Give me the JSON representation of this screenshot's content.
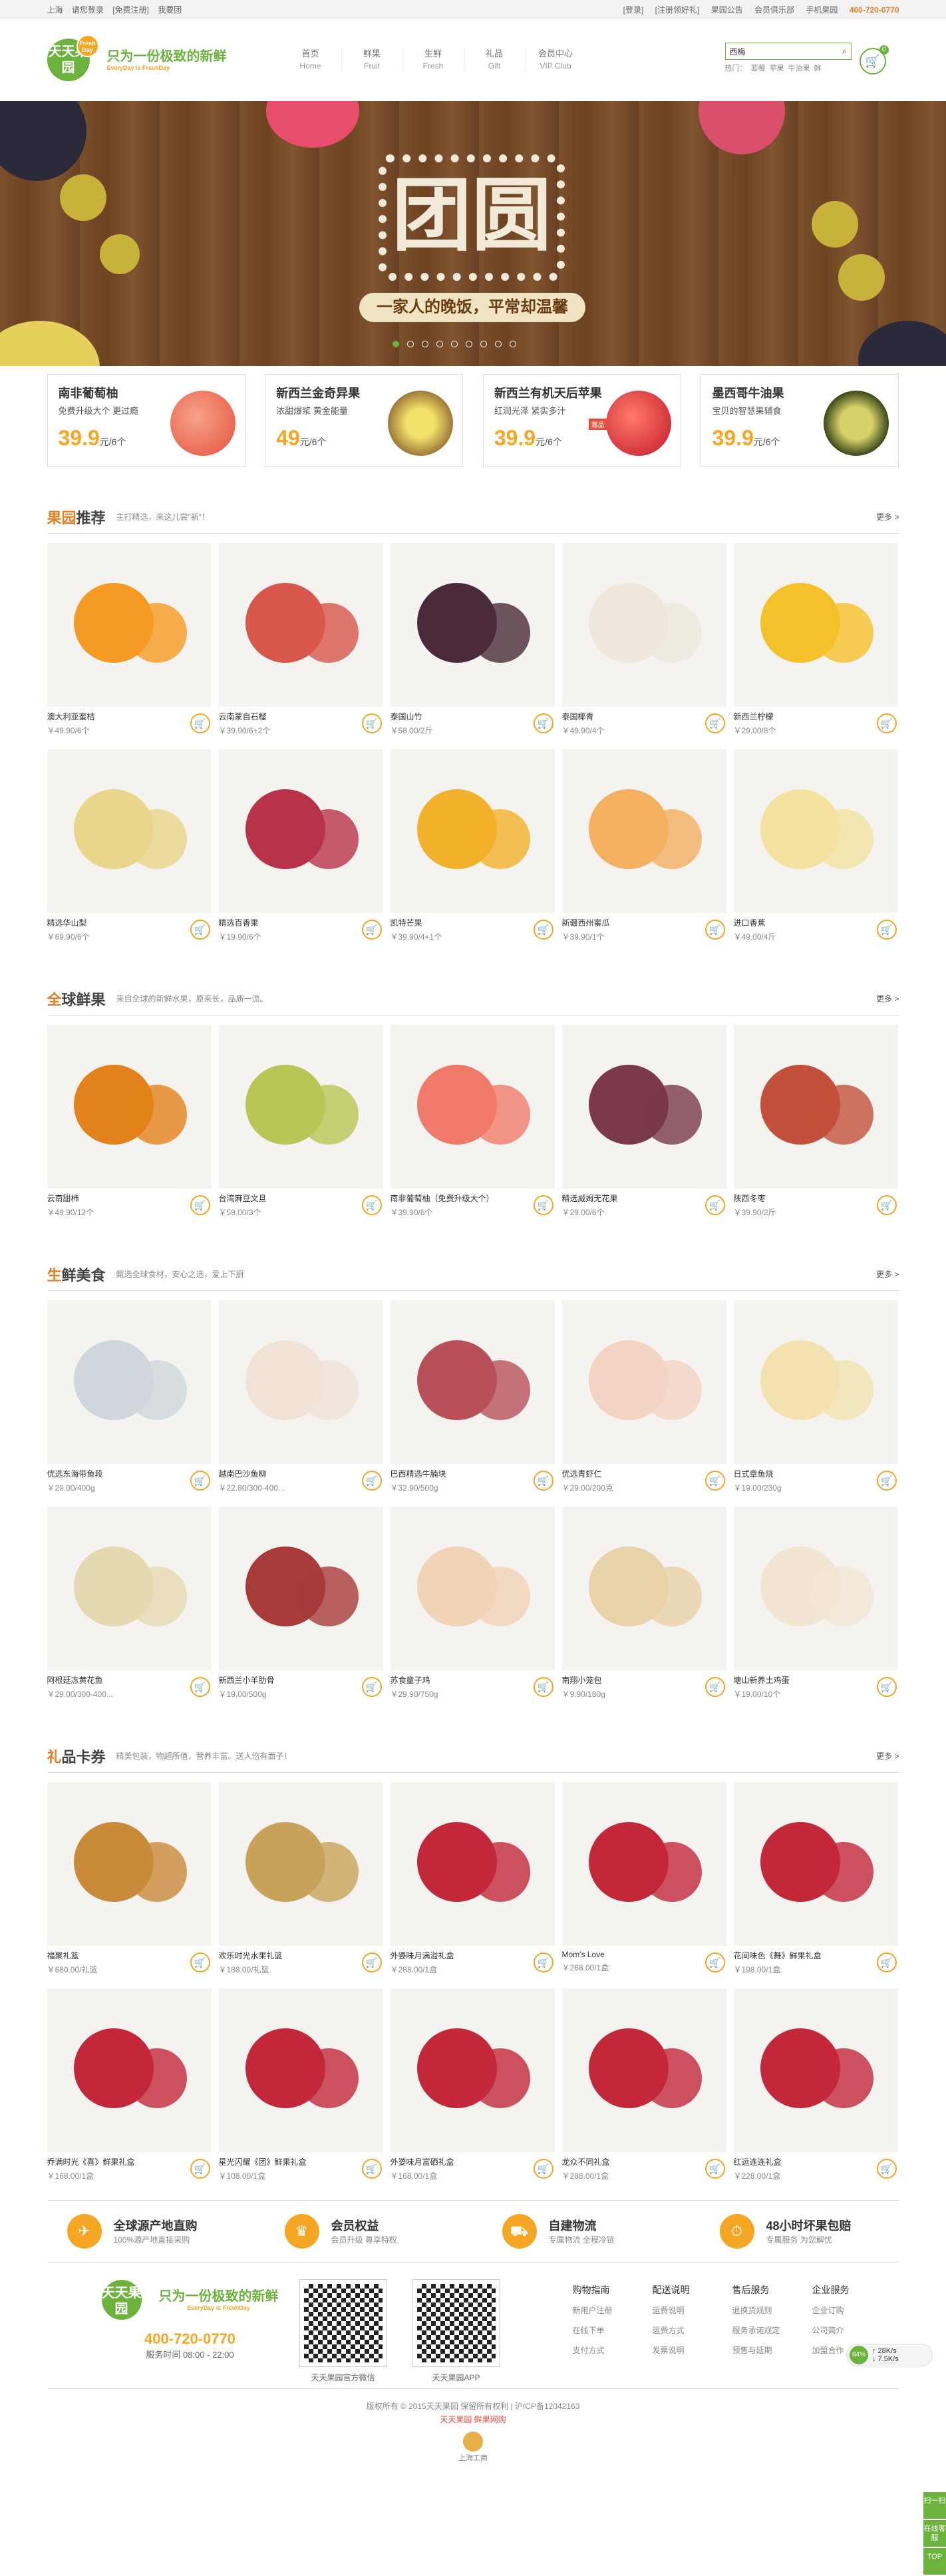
{
  "topbar": {
    "left": [
      "上海",
      "请您登录",
      "[免费注册]",
      "我要团"
    ],
    "right": [
      "[登录]",
      "[注册领好礼]",
      "果园公告",
      "会员俱乐部",
      "手机果园"
    ],
    "phone": "400-720-0770"
  },
  "logo": {
    "name": "天天果园",
    "tag": "Fresh Day",
    "slogan": "只为一份极致的新鲜",
    "slogan_en": "EveryDay is FreshDay"
  },
  "nav": [
    {
      "cn": "首页",
      "en": "Home"
    },
    {
      "cn": "鲜果",
      "en": "Fruit"
    },
    {
      "cn": "生鲜",
      "en": "Fresh"
    },
    {
      "cn": "礼品",
      "en": "Gift"
    },
    {
      "cn": "会员中心",
      "en": "VIP Club"
    }
  ],
  "search": {
    "placeholder": "西梅",
    "hot": [
      "热门：",
      "蓝莓",
      "苹果",
      "牛油果",
      "鲜"
    ]
  },
  "cart": {
    "count": "0"
  },
  "banner": {
    "title": "团圆",
    "slogan": "一家人的晚饭，平常却温馨"
  },
  "promos": [
    {
      "title": "南非葡萄柚",
      "desc": "免费升级大个 更过瘾",
      "price": "39.9",
      "unit": "元/6个",
      "tag": ""
    },
    {
      "title": "新西兰金奇异果",
      "desc": "浓甜爆浆 黄金能量",
      "price": "49",
      "unit": "元/6个",
      "tag": ""
    },
    {
      "title": "新西兰有机天后苹果",
      "desc": "红润光泽 紧实多汁",
      "price": "39.9",
      "unit": "元/6个",
      "tag": "赠品"
    },
    {
      "title": "墨西哥牛油果",
      "desc": "宝贝的智慧果辅食",
      "price": "39.9",
      "unit": "元/6个",
      "tag": ""
    }
  ],
  "sections": [
    {
      "title_first": "果园",
      "title_rest": "推荐",
      "subtitle": "主打精选，来这儿尝\"新\"！",
      "more": "更多 >",
      "items": [
        {
          "name": "澳大利亚蜜桔",
          "price": "￥49.90/6个"
        },
        {
          "name": "云南蒙自石榴",
          "price": "￥39.90/6+2个"
        },
        {
          "name": "泰国山竹",
          "price": "￥58.00/2斤"
        },
        {
          "name": "泰国椰青",
          "price": "￥49.90/4个"
        },
        {
          "name": "新西兰柠檬",
          "price": "￥29.00/8个"
        },
        {
          "name": "精选华山梨",
          "price": "￥69.90/6个"
        },
        {
          "name": "精选百香果",
          "price": "￥19.90/6个"
        },
        {
          "name": "凯特芒果",
          "price": "￥39.90/4+1个"
        },
        {
          "name": "新疆西州蜜瓜",
          "price": "￥39.90/1个"
        },
        {
          "name": "进口香蕉",
          "price": "￥49.00/4斤"
        }
      ]
    },
    {
      "title_first": "全",
      "title_rest": "球鲜果",
      "subtitle": "来自全球的新鲜水果，原来长，品质一流。",
      "more": "更多 >",
      "items": [
        {
          "name": "云南甜柿",
          "price": "￥49.90/12个"
        },
        {
          "name": "台湾麻豆文旦",
          "price": "￥59.00/3个"
        },
        {
          "name": "南非葡萄柚（免费升级大个）",
          "price": "￥39.90/6个"
        },
        {
          "name": "精选威姆无花果",
          "price": "￥29.00/6个"
        },
        {
          "name": "陕西冬枣",
          "price": "￥39.90/2斤"
        }
      ]
    },
    {
      "title_first": "生",
      "title_rest": "鲜美食",
      "subtitle": "甄选全球食材，安心之选，爱上下厨",
      "more": "更多 >",
      "items": [
        {
          "name": "优选东海带鱼段",
          "price": "￥29.00/400g"
        },
        {
          "name": "越南巴沙鱼柳",
          "price": "￥22.80/300-400..."
        },
        {
          "name": "巴西精选牛腩块",
          "price": "￥32.90/500g"
        },
        {
          "name": "优选青虾仁",
          "price": "￥29.00/200克"
        },
        {
          "name": "日式章鱼烧",
          "price": "￥19.00/230g"
        },
        {
          "name": "阿根廷冻黄花鱼",
          "price": "￥29.00/300-400..."
        },
        {
          "name": "新西兰小羊肋骨",
          "price": "￥19.00/500g"
        },
        {
          "name": "苏食童子鸡",
          "price": "￥29.90/750g"
        },
        {
          "name": "南翔小笼包",
          "price": "￥9.90/180g"
        },
        {
          "name": "塘山新养土鸡蛋",
          "price": "￥19.00/10个"
        }
      ]
    },
    {
      "title_first": "礼",
      "title_rest": "品卡券",
      "subtitle": "精美包装，物超所值，营养丰富。送人倍有面子！",
      "more": "更多 >",
      "items": [
        {
          "name": "福聚礼篮",
          "price": "￥680.00/礼篮"
        },
        {
          "name": "欢乐时光水果礼篮",
          "price": "￥188.00/礼篮"
        },
        {
          "name": "外婆味月满溢礼盒",
          "price": "￥288.00/1盒"
        },
        {
          "name": "Mom's Love",
          "price": "￥268.00/1盒"
        },
        {
          "name": "花间味色《舞》鲜果礼盒",
          "price": "￥198.00/1盒"
        },
        {
          "name": "乔满时光《喜》鲜果礼盒",
          "price": "￥168.00/1盒"
        },
        {
          "name": "星光闪耀《团》鲜果礼盒",
          "price": "￥108.00/1盒"
        },
        {
          "name": "外婆味月富硒礼盒",
          "price": "￥168.00/1盒"
        },
        {
          "name": "龙众不同礼盒",
          "price": "￥288.00/1盒"
        },
        {
          "name": "红运连连礼盒",
          "price": "￥228.00/1盒"
        }
      ]
    }
  ],
  "features": [
    {
      "title": "全球源产地直购",
      "desc": "100%源产地直接采购"
    },
    {
      "title": "会员权益",
      "desc": "会员升级 尊享特权"
    },
    {
      "title": "自建物流",
      "desc": "专属物流 全程冷链"
    },
    {
      "title": "48小时坏果包赔",
      "desc": "专属服务 为您解忧"
    }
  ],
  "footer": {
    "phone": "400-720-0770",
    "hours": "服务时间 08:00 - 22:00",
    "qr": [
      "天天果园官方微信",
      "天天果园APP"
    ],
    "columns": [
      {
        "title": "购物指南",
        "links": [
          "新用户注册",
          "在线下单",
          "支付方式"
        ]
      },
      {
        "title": "配送说明",
        "links": [
          "运费说明",
          "运费方式",
          "发票说明"
        ]
      },
      {
        "title": "售后服务",
        "links": [
          "退换货规则",
          "服务承诺规定",
          "预售与延期"
        ]
      },
      {
        "title": "企业服务",
        "links": [
          "企业订购",
          "公司简介",
          "加盟合作"
        ]
      }
    ],
    "copyright": "版权所有 © 2015天天果园 保留所有权利 | 沪ICP备12042163",
    "links_line": "天天果园 鲜果网购",
    "badge": "上海工商"
  },
  "floating": {
    "pct": "84%",
    "up": "↑ 28K/s",
    "down": "↓ 7.5K/s"
  },
  "sidebar": [
    "扫一扫",
    "在线客服",
    "TOP"
  ],
  "colors": {
    "green": "#6cb33e",
    "orange": "#f5a623"
  }
}
